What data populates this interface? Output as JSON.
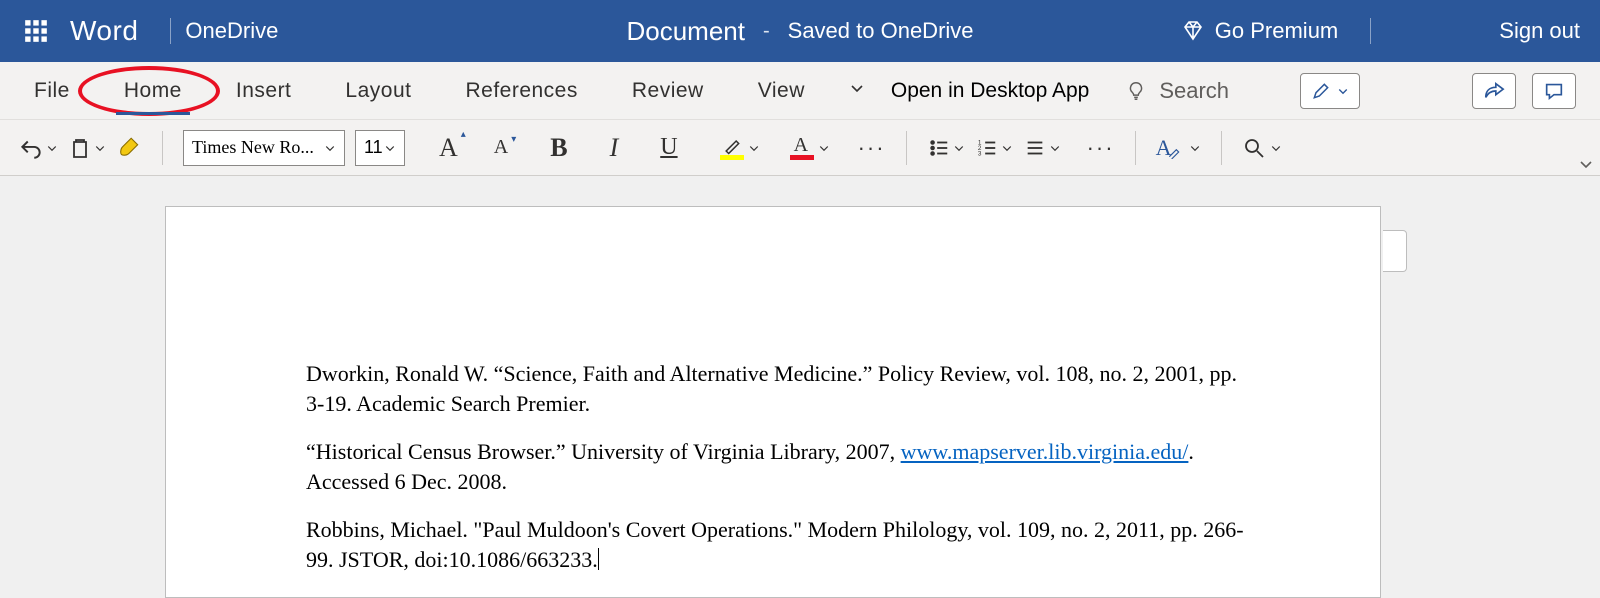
{
  "titlebar": {
    "app": "Word",
    "location": "OneDrive",
    "doc_title": "Document",
    "dash": "-",
    "status": "Saved to OneDrive",
    "premium": "Go Premium",
    "signout": "Sign out"
  },
  "tabs": {
    "file": "File",
    "home": "Home",
    "insert": "Insert",
    "layout": "Layout",
    "references": "References",
    "review": "Review",
    "view": "View",
    "open_desktop": "Open in Desktop App",
    "search": "Search"
  },
  "ribbon": {
    "font_name": "Times New Ro...",
    "font_size": "11"
  },
  "document": {
    "p1": "Dworkin, Ronald W. “Science, Faith and Alternative Medicine.” Policy Review, vol. 108, no. 2, 2001, pp. 3-19. Academic Search Premier.",
    "p2a": "“Historical Census Browser.” University of Virginia Library, 2007, ",
    "p2link": "www.mapserver.lib.virginia.edu/",
    "p2b": ". Accessed 6 Dec. 2008.",
    "p3": "Robbins, Michael. \"Paul Muldoon's Covert Operations.\" Modern Philology, vol. 109, no. 2, 2011, pp. 266-99. JSTOR, doi:10.1086/663233."
  }
}
